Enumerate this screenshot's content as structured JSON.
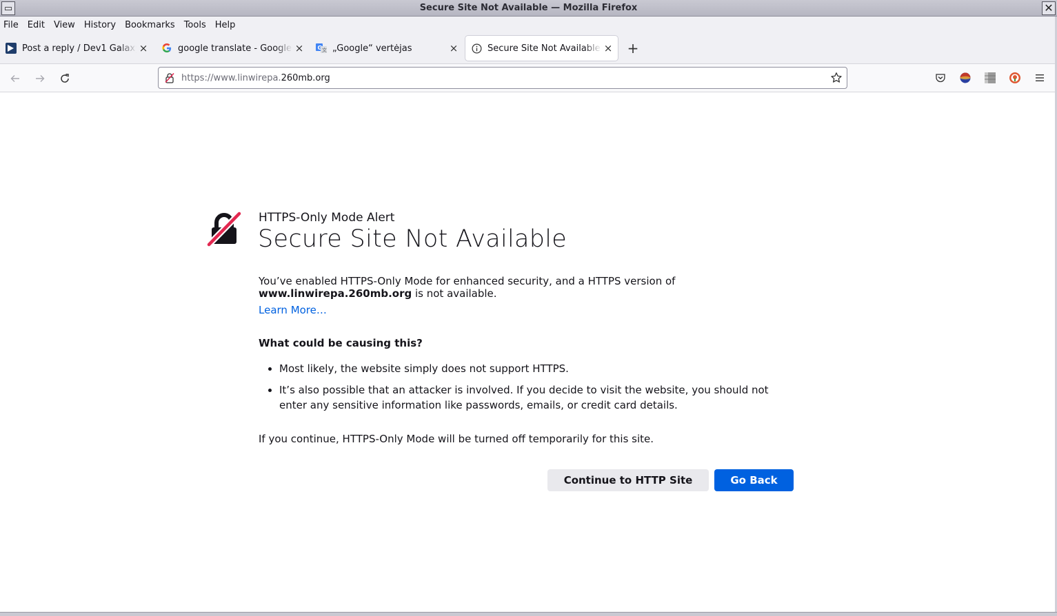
{
  "window": {
    "title": "Secure Site Not Available — Mozilla Firefox",
    "menu_glyph": "▭",
    "close_glyph": "✕"
  },
  "menubar": {
    "items": [
      "File",
      "Edit",
      "View",
      "History",
      "Bookmarks",
      "Tools",
      "Help"
    ]
  },
  "tabs": [
    {
      "label": "Post a reply / Dev1 Galaxy Forum",
      "icon": "dev1-galaxy-icon",
      "active": false
    },
    {
      "label": "google translate - Google Search",
      "icon": "google-g-icon",
      "active": false
    },
    {
      "label": "„Google“ vertėjas",
      "icon": "google-translate-icon",
      "active": false
    },
    {
      "label": "Secure Site Not Available",
      "icon": "info-icon",
      "active": true
    }
  ],
  "tab_close_glyph": "×",
  "new_tab_glyph": "+",
  "urlbar": {
    "url_prefix": "https://www.linwirepa.",
    "url_domain": "260mb.org"
  },
  "error": {
    "subtitle": "HTTPS-Only Mode Alert",
    "title": "Secure Site Not Available",
    "desc_part1": "You’ve enabled HTTPS-Only Mode for enhanced security, and a HTTPS version of",
    "desc_domain": "www.linwirepa.260mb.org",
    "desc_part2": " is not available.",
    "learn_more": "Learn More…",
    "cause_heading": "What could be causing this?",
    "causes": [
      "Most likely, the website simply does not support HTTPS.",
      "It’s also possible that an attacker is involved. If you decide to visit the website, you should not enter any sensitive information like passwords, emails, or credit card details."
    ],
    "continue_note": "If you continue, HTTPS-Only Mode will be turned off temporarily for this site.",
    "continue_button": "Continue to HTTP Site",
    "back_button": "Go Back"
  },
  "colors": {
    "accent": "#0061e0",
    "strike": "#e22850"
  }
}
